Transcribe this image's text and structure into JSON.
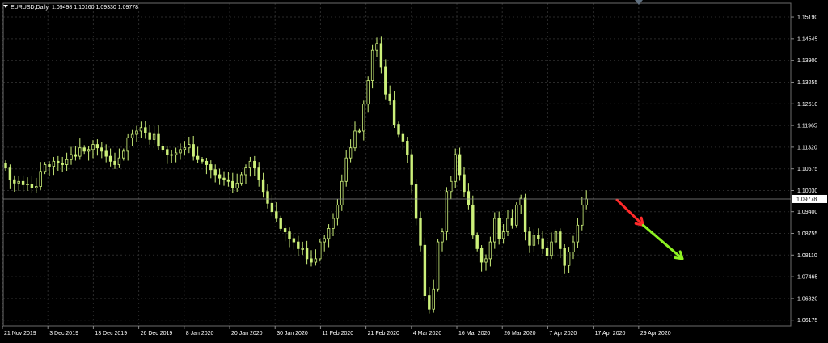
{
  "window": {
    "title": "EURUSD,Daily",
    "ohlc_readout": "1.09498 1.10160 1.09330 1.09778"
  },
  "colors": {
    "background": "#000000",
    "grid": "#2a2a2a",
    "candle": "#ccf07a",
    "axis_text": "#ffffff",
    "current_price_label_bg": "#ffffff",
    "current_price_label_text": "#000000",
    "arrow_down_red": "#ff2a2a",
    "arrow_down_green": "#8ef222"
  },
  "chart_data": {
    "type": "candlestick",
    "symbol": "EURUSD",
    "timeframe": "Daily",
    "ylim": [
      1.06,
      1.156
    ],
    "y_ticks": [
      "1.15190",
      "1.14545",
      "1.13900",
      "1.13255",
      "1.12610",
      "1.11965",
      "1.11320",
      "1.10675",
      "1.10030",
      "1.09400",
      "1.08755",
      "1.08110",
      "1.07465",
      "1.06820",
      "1.06175"
    ],
    "x_ticks": [
      "21 Nov 2019",
      "3 Dec 2019",
      "13 Dec 2019",
      "26 Dec 2019",
      "8 Jan 2020",
      "20 Jan 2020",
      "30 Jan 2020",
      "11 Feb 2020",
      "21 Feb 2020",
      "4 Mar 2020",
      "16 Mar 2020",
      "26 Mar 2020",
      "7 Apr 2020",
      "17 Apr 2020",
      "29 Apr 2020"
    ],
    "current_price": "1.09778",
    "closes": [
      1.107,
      1.1035,
      1.1025,
      1.103,
      1.102,
      1.1022,
      1.101,
      1.1015,
      1.106,
      1.108,
      1.1075,
      1.109,
      1.1085,
      1.108,
      1.1095,
      1.111,
      1.1105,
      1.113,
      1.112,
      1.1125,
      1.114,
      1.113,
      1.112,
      1.1105,
      1.109,
      1.108,
      1.11,
      1.112,
      1.116,
      1.117,
      1.118,
      1.119,
      1.1175,
      1.1155,
      1.117,
      1.1135,
      1.1125,
      1.111,
      1.111,
      1.1115,
      1.1125,
      1.113,
      1.114,
      1.1105,
      1.1095,
      1.109,
      1.108,
      1.1065,
      1.105,
      1.104,
      1.1035,
      1.103,
      1.101,
      1.1025,
      1.105,
      1.107,
      1.109,
      1.107,
      1.1035,
      1.1,
      1.0965,
      1.094,
      1.092,
      1.089,
      1.088,
      1.086,
      1.085,
      1.083,
      1.083,
      1.08,
      1.079,
      1.08,
      1.085,
      1.086,
      1.089,
      1.092,
      1.096,
      1.103,
      1.11,
      1.113,
      1.118,
      1.118,
      1.126,
      1.133,
      1.142,
      1.144,
      1.137,
      1.129,
      1.127,
      1.12,
      1.117,
      1.115,
      1.111,
      1.102,
      1.092,
      1.084,
      1.069,
      1.065,
      1.071,
      1.085,
      1.088,
      1.1,
      1.103,
      1.111,
      1.105,
      1.1,
      1.096,
      1.087,
      1.083,
      1.079,
      1.08,
      1.085,
      1.092,
      1.086,
      1.088,
      1.092,
      1.09,
      1.096,
      1.098,
      1.088,
      1.084,
      1.087,
      1.086,
      1.083,
      1.081,
      1.085,
      1.088,
      1.083,
      1.078,
      1.082,
      1.085,
      1.09,
      1.096,
      1.0978
    ],
    "projection_arrows": [
      {
        "color_key": "arrow_down_red",
        "from_bar": 140,
        "from_price": 1.0975,
        "to_bar": 146,
        "to_price": 1.09
      },
      {
        "color_key": "arrow_down_green",
        "from_bar": 146,
        "from_price": 1.09,
        "to_bar": 155,
        "to_price": 1.08
      }
    ]
  }
}
